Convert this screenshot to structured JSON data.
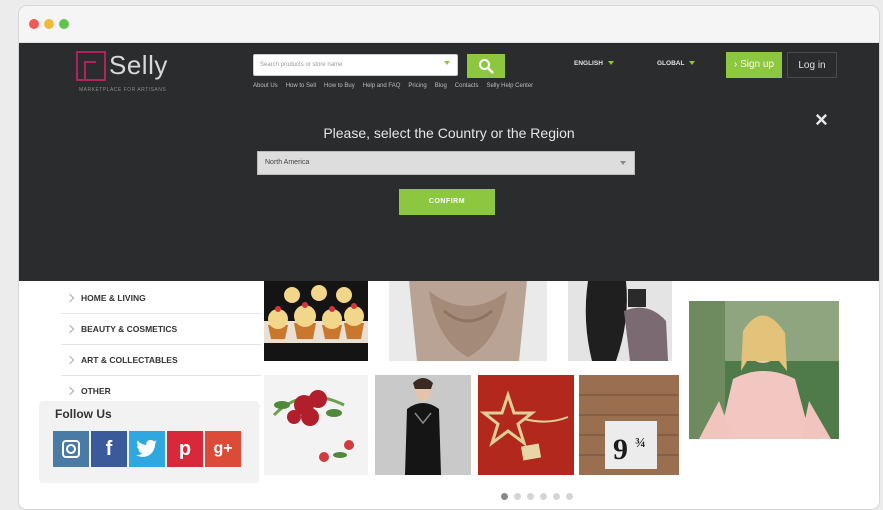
{
  "window": {
    "controls": [
      "close",
      "minimize",
      "maximize"
    ]
  },
  "header": {
    "logo_text": "Selly",
    "logo_tagline": "MARKETPLACE FOR ARTISANS",
    "search_placeholder": "Search products or store name",
    "nav_links": [
      "About Us",
      "How to Sell",
      "How to Buy",
      "Help and FAQ",
      "Pricing",
      "Blog",
      "Contacts",
      "Selly Help Center"
    ],
    "language": "ENGLISH",
    "region": "GLOBAL",
    "signup_label": "Sign up",
    "login_label": "Log in"
  },
  "modal": {
    "title": "Please, select the Country or the Region",
    "selected_region": "North America",
    "confirm_label": "CONFIRM",
    "close_icon": "×"
  },
  "sidebar": {
    "categories": [
      "HOME & LIVING",
      "BEAUTY & COSMETICS",
      "ART & COLLECTABLES",
      "OTHER"
    ],
    "follow_title": "Follow Us",
    "socials": [
      {
        "name": "instagram-icon",
        "glyph": "◘"
      },
      {
        "name": "facebook-icon",
        "glyph": "f"
      },
      {
        "name": "twitter-icon",
        "glyph": "t"
      },
      {
        "name": "pinterest-icon",
        "glyph": "p"
      },
      {
        "name": "google-plus-icon",
        "glyph": "g+"
      }
    ]
  },
  "gallery": {
    "pager_count": 6,
    "active_page": 1
  },
  "colors": {
    "accent": "#8dc63f",
    "header_bg": "#2b2c2e",
    "brand": "#b0245e"
  }
}
